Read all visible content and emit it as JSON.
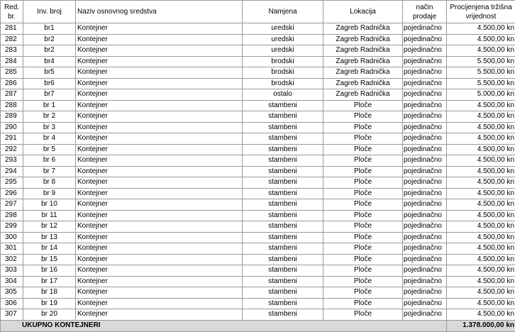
{
  "headers": {
    "rb": "Red. br.",
    "inv": "Inv. broj",
    "naziv": "Naziv osnovnog sredstva",
    "namjena": "Namjena",
    "lokacija": "Lokacija",
    "nacin": "način prodaje",
    "vrijednost": "Procijenjena tržišna vrijednost"
  },
  "rows": [
    {
      "rb": "281",
      "inv": "br1",
      "naziv": "Kontejner",
      "namjena": "uredski",
      "lokacija": "Zagreb Radnička",
      "nacin": "pojedinačno",
      "vrijednost": "4.500,00 kn"
    },
    {
      "rb": "282",
      "inv": "br2",
      "naziv": "Kontejner",
      "namjena": "uredski",
      "lokacija": "Zagreb Radnička",
      "nacin": "pojedinačno",
      "vrijednost": "4.500,00 kn"
    },
    {
      "rb": "283",
      "inv": "br2",
      "naziv": "Kontejner",
      "namjena": "uredski",
      "lokacija": "Zagreb Radnička",
      "nacin": "pojedinačno",
      "vrijednost": "4.500,00 kn"
    },
    {
      "rb": "284",
      "inv": "br4",
      "naziv": "Kontejner",
      "namjena": "brodski",
      "lokacija": "Zagreb Radnička",
      "nacin": "pojedinačno",
      "vrijednost": "5.500,00 kn"
    },
    {
      "rb": "285",
      "inv": "br5",
      "naziv": "Kontejner",
      "namjena": "brodski",
      "lokacija": "Zagreb Radnička",
      "nacin": "pojedinačno",
      "vrijednost": "5.500,00 kn"
    },
    {
      "rb": "286",
      "inv": "br6",
      "naziv": "Kontejner",
      "namjena": "brodski",
      "lokacija": "Zagreb Radnička",
      "nacin": "pojedinačno",
      "vrijednost": "5.500,00 kn"
    },
    {
      "rb": "287",
      "inv": "br7",
      "naziv": "Kontejner",
      "namjena": "ostalo",
      "lokacija": "Zagreb Radnička",
      "nacin": "pojedinačno",
      "vrijednost": "5.000,00 kn"
    },
    {
      "rb": "288",
      "inv": "br 1",
      "naziv": "Kontejner",
      "namjena": "stambeni",
      "lokacija": "Ploče",
      "nacin": "pojedinačno",
      "vrijednost": "4.500,00 kn"
    },
    {
      "rb": "289",
      "inv": "br 2",
      "naziv": "Kontejner",
      "namjena": "stambeni",
      "lokacija": "Ploče",
      "nacin": "pojedinačno",
      "vrijednost": "4.500,00 kn"
    },
    {
      "rb": "290",
      "inv": "br 3",
      "naziv": "Kontejner",
      "namjena": "stambeni",
      "lokacija": "Ploče",
      "nacin": "pojedinačno",
      "vrijednost": "4.500,00 kn"
    },
    {
      "rb": "291",
      "inv": "br 4",
      "naziv": "Kontejner",
      "namjena": "stambeni",
      "lokacija": "Ploče",
      "nacin": "pojedinačno",
      "vrijednost": "4.500,00 kn"
    },
    {
      "rb": "292",
      "inv": "br 5",
      "naziv": "Kontejner",
      "namjena": "stambeni",
      "lokacija": "Ploče",
      "nacin": "pojedinačno",
      "vrijednost": "4.500,00 kn"
    },
    {
      "rb": "293",
      "inv": "br 6",
      "naziv": "Kontejner",
      "namjena": "stambeni",
      "lokacija": "Ploče",
      "nacin": "pojedinačno",
      "vrijednost": "4.500,00 kn"
    },
    {
      "rb": "294",
      "inv": "br 7",
      "naziv": "Kontejner",
      "namjena": "stambeni",
      "lokacija": "Ploče",
      "nacin": "pojedinačno",
      "vrijednost": "4.500,00 kn"
    },
    {
      "rb": "295",
      "inv": "br 8",
      "naziv": "Kontejner",
      "namjena": "stambeni",
      "lokacija": "Ploče",
      "nacin": "pojedinačno",
      "vrijednost": "4.500,00 kn"
    },
    {
      "rb": "296",
      "inv": "br 9",
      "naziv": "Kontejner",
      "namjena": "stambeni",
      "lokacija": "Ploče",
      "nacin": "pojedinačno",
      "vrijednost": "4.500,00 kn"
    },
    {
      "rb": "297",
      "inv": "br 10",
      "naziv": "Kontejner",
      "namjena": "stambeni",
      "lokacija": "Ploče",
      "nacin": "pojedinačno",
      "vrijednost": "4.500,00 kn"
    },
    {
      "rb": "298",
      "inv": "br 11",
      "naziv": "Kontejner",
      "namjena": "stambeni",
      "lokacija": "Ploče",
      "nacin": "pojedinačno",
      "vrijednost": "4.500,00 kn"
    },
    {
      "rb": "299",
      "inv": "br 12",
      "naziv": "Kontejner",
      "namjena": "stambeni",
      "lokacija": "Ploče",
      "nacin": "pojedinačno",
      "vrijednost": "4.500,00 kn"
    },
    {
      "rb": "300",
      "inv": "br 13",
      "naziv": "Kontejner",
      "namjena": "stambeni",
      "lokacija": "Ploče",
      "nacin": "pojedinačno",
      "vrijednost": "4.500,00 kn"
    },
    {
      "rb": "301",
      "inv": "br 14",
      "naziv": "Kontejner",
      "namjena": "stambeni",
      "lokacija": "Ploče",
      "nacin": "pojedinačno",
      "vrijednost": "4.500,00 kn"
    },
    {
      "rb": "302",
      "inv": "br 15",
      "naziv": "Kontejner",
      "namjena": "stambeni",
      "lokacija": "Ploče",
      "nacin": "pojedinačno",
      "vrijednost": "4.500,00 kn"
    },
    {
      "rb": "303",
      "inv": "br 16",
      "naziv": "Kontejner",
      "namjena": "stambeni",
      "lokacija": "Ploče",
      "nacin": "pojedinačno",
      "vrijednost": "4.500,00 kn"
    },
    {
      "rb": "304",
      "inv": "br 17",
      "naziv": "Kontejner",
      "namjena": "stambeni",
      "lokacija": "Ploče",
      "nacin": "pojedinačno",
      "vrijednost": "4.500,00 kn"
    },
    {
      "rb": "305",
      "inv": "br 18",
      "naziv": "Kontejner",
      "namjena": "stambeni",
      "lokacija": "Ploče",
      "nacin": "pojedinačno",
      "vrijednost": "4.500,00 kn"
    },
    {
      "rb": "306",
      "inv": "br 19",
      "naziv": "Kontejner",
      "namjena": "stambeni",
      "lokacija": "Ploče",
      "nacin": "pojedinačno",
      "vrijednost": "4.500,00 kn"
    },
    {
      "rb": "307",
      "inv": "br 20",
      "naziv": "Kontejner",
      "namjena": "stambeni",
      "lokacija": "Ploče",
      "nacin": "pojedinačno",
      "vrijednost": "4.500,00 kn"
    }
  ],
  "total": {
    "label": "UKUPNO KONTEJNERI",
    "value": "1.378.000,00 kn"
  }
}
